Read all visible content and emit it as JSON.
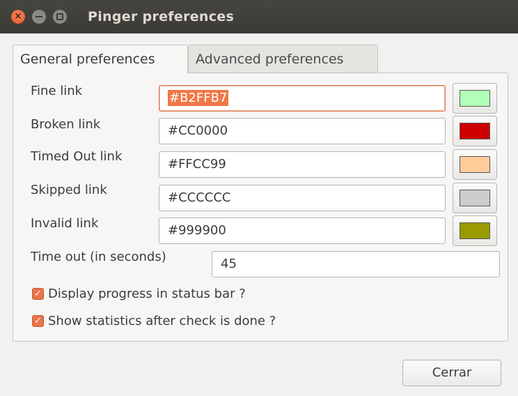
{
  "window": {
    "title": "Pinger preferences"
  },
  "tabs": [
    {
      "label": "General preferences",
      "active": true
    },
    {
      "label": "Advanced preferences",
      "active": false
    }
  ],
  "colors": [
    {
      "label": "Fine link",
      "value": "#B2FFB7",
      "swatch": "#B2FFB7"
    },
    {
      "label": "Broken link",
      "value": "#CC0000",
      "swatch": "#CC0000"
    },
    {
      "label": "Timed Out link",
      "value": "#FFCC99",
      "swatch": "#FFCC99"
    },
    {
      "label": "Skipped link",
      "value": "#CCCCCC",
      "swatch": "#CCCCCC"
    },
    {
      "label": "Invalid link",
      "value": "#999900",
      "swatch": "#999900"
    }
  ],
  "timeout": {
    "label": "Time out (in seconds)",
    "value": "45"
  },
  "checkboxes": [
    {
      "label": "Display progress in status bar ?",
      "checked": true
    },
    {
      "label": "Show statistics after check is done ?",
      "checked": true
    }
  ],
  "buttons": {
    "close": "Cerrar"
  }
}
